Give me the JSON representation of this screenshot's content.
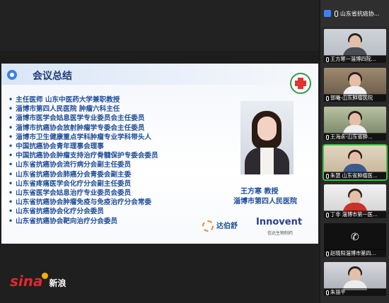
{
  "slide": {
    "title": "会议总结",
    "titles": [
      "主任医师  山东中医药大学兼职教授",
      "淄博市第四人民医院 肿瘤六科主任",
      "淄博市医学会姑息医学专业委员会主任委员",
      "淄博市抗癌协会放射肿瘤学专委会主任委员",
      "淄博市卫生健康重点学科肿瘤专业学科带头人",
      "中国抗癌协会青年理事会理事",
      "中国抗癌协会肿瘤支持治疗骨髓保护专委会委员",
      "山东省抗癌协会流行病分会副主任委员",
      "山东省抗癌协会肺癌分会青委会副主委",
      "山东省疼痛医学会化疗分会副主任委员",
      "山东省医学会姑息治疗专业委员会委员",
      "山东省抗癌协会肿瘤免疫与免疫治疗分会常委",
      "山东省抗癌协会化疗分会委员",
      "山东省抗癌协会靶向治疗分会委员"
    ],
    "speaker_name": "王方寒 教授",
    "speaker_hospital": "淄博市第四人民医院",
    "sponsor_logo_1": "达伯舒",
    "sponsor_logo_2": "Innovent",
    "sponsor_logo_2_sub": "信达生物制药"
  },
  "watermark": {
    "brand": "sina",
    "brand_cn": "新浪"
  },
  "sidebar": {
    "header_label": "山东省抗癌协...",
    "participants": [
      {
        "name": "王方寒一淄博四院...",
        "active": false
      },
      {
        "name": "郭曦-山东肿瘤医院",
        "active": false
      },
      {
        "name": "王海永-山东省肿...",
        "active": false
      },
      {
        "name": "朱慧 山东省肿瘤医...",
        "active": true
      },
      {
        "name": "丁非 淄博市第一医...",
        "active": false
      },
      {
        "name": "赵晓阳淄博市第四...",
        "active": false
      },
      {
        "name": "朱丽平",
        "active": false
      }
    ]
  },
  "colors": {
    "accent_blue": "#1f4d98",
    "active_outline": "#3fbf3f",
    "sina_red": "#e3262d"
  }
}
